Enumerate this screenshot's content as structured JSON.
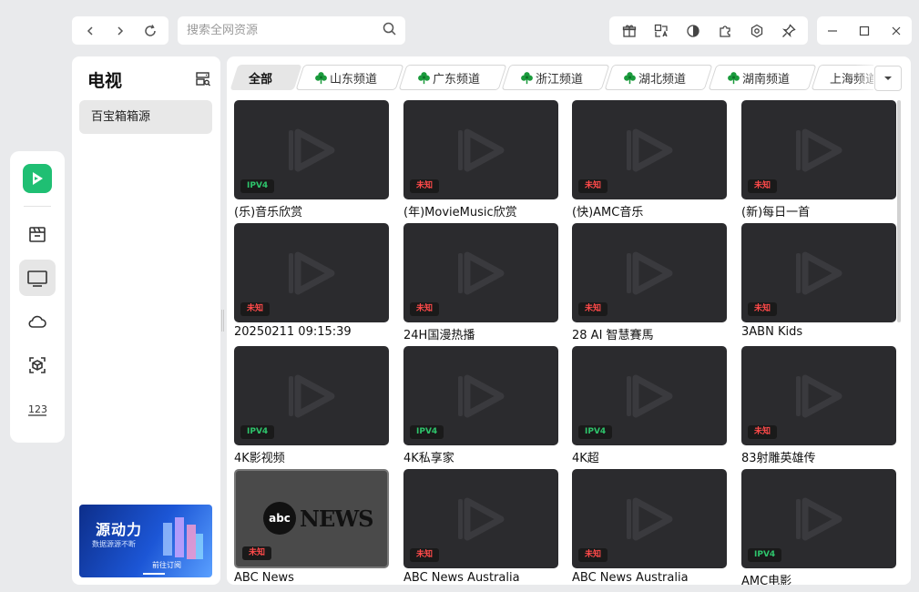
{
  "search": {
    "placeholder": "搜索全网资源"
  },
  "sidebar": {
    "title": "电视",
    "items": [
      {
        "label": "百宝箱箱源"
      }
    ],
    "banner": {
      "title": "源动力",
      "subtitle": "数据源源不断",
      "cta": "前往订阅"
    }
  },
  "tabs": [
    {
      "label": "全部",
      "active": true,
      "icon": ""
    },
    {
      "label": "山东频道",
      "icon": "clover-icon"
    },
    {
      "label": "广东频道",
      "icon": "clover-icon"
    },
    {
      "label": "浙江频道",
      "icon": "clover-icon"
    },
    {
      "label": "湖北频道",
      "icon": "clover-icon"
    },
    {
      "label": "湖南频道",
      "icon": "clover-icon"
    },
    {
      "label": "上海频道",
      "icon": ""
    }
  ],
  "badges": {
    "ipv4": "IPV4",
    "unknown": "未知"
  },
  "channels": [
    {
      "name": "(乐)音乐欣赏",
      "badge": "IPV4"
    },
    {
      "name": "(年)MovieMusic欣赏",
      "badge": "未知"
    },
    {
      "name": "(快)AMC音乐",
      "badge": "未知"
    },
    {
      "name": "(新)每日一首",
      "badge": "未知"
    },
    {
      "name": "20250211 09:15:39",
      "badge": "未知"
    },
    {
      "name": "24H国漫热播",
      "badge": "未知"
    },
    {
      "name": "28 AI 智慧賽馬",
      "badge": "未知"
    },
    {
      "name": "3ABN Kids",
      "badge": "未知"
    },
    {
      "name": "4K影视频",
      "badge": "IPV4"
    },
    {
      "name": "4K私享家",
      "badge": "IPV4"
    },
    {
      "name": "4K超",
      "badge": "IPV4"
    },
    {
      "name": "83射雕英雄传",
      "badge": "未知"
    },
    {
      "name": "ABC News",
      "badge": "未知",
      "logo": "abc NEWS"
    },
    {
      "name": "ABC News Australia",
      "badge": "未知"
    },
    {
      "name": "ABC News Australia",
      "badge": "未知"
    },
    {
      "name": "AMC电影",
      "badge": "IPV4"
    }
  ],
  "colors": {
    "accent": "#1fbf73",
    "ipv4": "#2ec46b",
    "unknown": "#ff4a4a",
    "thumb": "#2b2b2e"
  }
}
